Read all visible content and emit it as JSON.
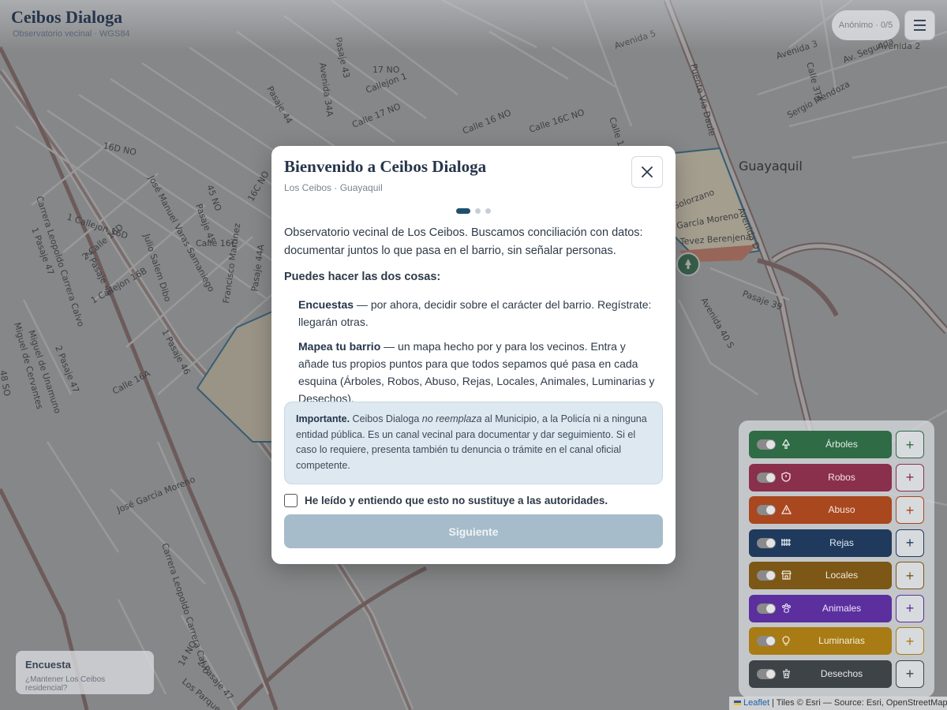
{
  "header": {
    "brand_title": "Ceibos Dialoga",
    "brand_subtitle": "Observatorio vecinal · WGS84",
    "user_label": "Anónimo · 0/5",
    "menu_icon": "hamburger-icon"
  },
  "map": {
    "city_label": "Guayaquil",
    "street_labels": [
      "Pasaje 43",
      "Avenida 34A",
      "17 NO",
      "Callejon 1",
      "Calle 17 NO",
      "Calle 16C NO",
      "Pasaje 44",
      "16D NO",
      "José Manuel Varas Samaniego",
      "Pasaje 45",
      "16C NO",
      "45 NO",
      "1 Callejon 16D",
      "2 Calle 16D",
      "2 Pasaje 46",
      "Julio Salem Dibo",
      "Calle 16C",
      "1 Callejon 16B",
      "1 Pasaje 46",
      "Carrera Leopoldo Carrera Calvo",
      "1 Pasaje 47",
      "2 Pasaje 47",
      "Miguel de Unamuno",
      "Miguel de Cervantes",
      "Francisco Martinez",
      "Pasaje 44A",
      "Calle 16A",
      "Avenida 5",
      "Puente Via Daule",
      "Avenida 3",
      "Calle 3TA",
      "Av. Segunda",
      "Sergio Mendoza",
      "Pasaje 39",
      "Avenida 40 S",
      "Avenida 2",
      "Calle 1",
      "José García Moreno",
      "14 NO",
      "2 Pasaje 47",
      "Carrera Leopoldo Carrera Calvo",
      "Los Parques",
      "48 SO",
      "Avenida D",
      "Solorzano",
      "García Moreno",
      "Tevez Berenjena",
      "Calle 16 NO"
    ],
    "marker_icon": "tree-marker-icon"
  },
  "modal": {
    "title": "Bienvenido a Ceibos Dialoga",
    "subtitle": "Los Ceibos · Guayaquil",
    "close_icon": "close-icon",
    "steps_total": 3,
    "steps_current": 1,
    "intro": "Observatorio vecinal de Los Ceibos. Buscamos conciliación con datos: documentar juntos lo que pasa en el barrio, sin señalar personas.",
    "both_heading": "Puedes hacer las dos cosas:",
    "option1_title": "Encuestas",
    "option1_text": " — por ahora, decidir sobre el carácter del barrio. Regístrate: llegarán otras.",
    "option2_title": "Mapea tu barrio",
    "option2_text": " — un mapa hecho por y para los vecinos. Entra y añade tus propios puntos para que todos sepamos qué pasa en cada esquina (Árboles, Robos, Abuso, Rejas, Locales, Animales, Luminarias y Desechos).",
    "notice_title": "Importante.",
    "notice_part1": " Ceibos Dialoga ",
    "notice_em": "no reemplaza",
    "notice_part2": " al Municipio, a la Policía ni a ninguna entidad pública. Es un canal vecinal para documentar y dar seguimiento. Si el caso lo requiere, presenta también tu denuncia o trámite en el canal oficial competente.",
    "ack_label": "He leído y entiendo que esto no sustituye a las autoridades.",
    "ack_checked": false,
    "next_label": "Siguiente"
  },
  "layers": [
    {
      "label": "Árboles",
      "icon": "tree-icon",
      "color": "#2f6b45",
      "text_color": "#e3efe6",
      "add_color": "#2f6b45"
    },
    {
      "label": "Robos",
      "icon": "shield-icon",
      "color": "#8a2f4c",
      "text_color": "#f4e3e8",
      "add_color": "#8a2f4c"
    },
    {
      "label": "Abuso",
      "icon": "warning-icon",
      "color": "#a9471f",
      "text_color": "#f6e6dc",
      "add_color": "#a9471f"
    },
    {
      "label": "Rejas",
      "icon": "fence-icon",
      "color": "#1f3a5c",
      "text_color": "#e2e9f2",
      "add_color": "#1f3a5c"
    },
    {
      "label": "Locales",
      "icon": "store-icon",
      "color": "#7c5716",
      "text_color": "#f2eadb",
      "add_color": "#7c5716"
    },
    {
      "label": "Animales",
      "icon": "paw-icon",
      "color": "#5b2f9e",
      "text_color": "#ece4f7",
      "add_color": "#5b2f9e"
    },
    {
      "label": "Luminarias",
      "icon": "bulb-icon",
      "color": "#a87b14",
      "text_color": "#f6efdc",
      "add_color": "#a87b14"
    },
    {
      "label": "Desechos",
      "icon": "trash-icon",
      "color": "#3e4347",
      "text_color": "#e8e9ea",
      "add_color": "#3e4347"
    }
  ],
  "layers_add_symbol": "+",
  "survey": {
    "title": "Encuesta",
    "question": "¿Mantener Los Ceibos residencial?"
  },
  "attribution": {
    "leaflet": "Leaflet",
    "tiles": " | Tiles © Esri — Source: Esri, OpenStreetMap"
  }
}
